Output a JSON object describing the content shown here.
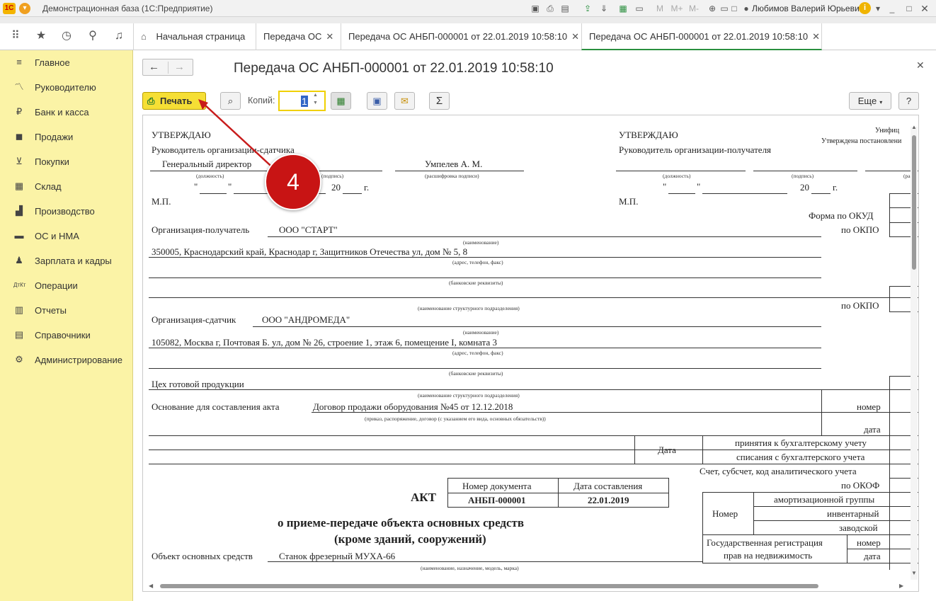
{
  "titlebar": {
    "title": "Демонстрационная база  (1С:Предприятие)",
    "user": "Любимов Валерий Юрьевич",
    "m_labels": [
      "M",
      "M+",
      "M-"
    ]
  },
  "tabs": [
    "Начальная страница",
    "Передача ОС",
    "Передача ОС АНБП-000001 от 22.01.2019 10:58:10",
    "Передача ОС АНБП-000001 от 22.01.2019 10:58:10"
  ],
  "sidebar": [
    {
      "label": "Главное",
      "icon": "menu-icon"
    },
    {
      "label": "Руководителю",
      "icon": "chart-line-icon"
    },
    {
      "label": "Банк и касса",
      "icon": "ruble-icon"
    },
    {
      "label": "Продажи",
      "icon": "bag-icon"
    },
    {
      "label": "Покупки",
      "icon": "cart-icon"
    },
    {
      "label": "Склад",
      "icon": "warehouse-icon"
    },
    {
      "label": "Производство",
      "icon": "factory-icon"
    },
    {
      "label": "ОС и НМА",
      "icon": "truck-icon"
    },
    {
      "label": "Зарплата и кадры",
      "icon": "person-icon"
    },
    {
      "label": "Операции",
      "icon": "dt-kt-icon"
    },
    {
      "label": "Отчеты",
      "icon": "bars-icon"
    },
    {
      "label": "Справочники",
      "icon": "book-icon"
    },
    {
      "label": "Администрирование",
      "icon": "gear-icon"
    }
  ],
  "page": {
    "title": "Передача ОС АНБП-000001 от 22.01.2019 10:58:10"
  },
  "toolbar": {
    "print_label": "Печать",
    "copies_label": "Копий:",
    "copies_value": "1",
    "more_label": "Еще",
    "help_label": "?",
    "sigma_label": "Σ"
  },
  "callout": {
    "number": "4"
  },
  "form": {
    "approve": "УТВЕРЖДАЮ",
    "head_sender": "Руководитель организации-сдатчика",
    "head_receiver": "Руководитель организации-получателя",
    "position": "Генеральный директор",
    "signer": "Умпелев А. М.",
    "cap_position": "(должность)",
    "cap_sign": "(подпись)",
    "cap_decode": "(расшифровка подписи)",
    "cap_decode_cut": "(расш",
    "quote": "\"",
    "year": "20",
    "g": "г.",
    "mp": "М.П.",
    "unif": "Унифиц",
    "approved_by": "Утверждена постановлени",
    "okud": "Форма по ОКУД",
    "okpo": "по ОКПО",
    "org_receiver_label": "Организация-получатель",
    "org_receiver": "ООО \"СТАРТ\"",
    "cap_name": "(наименование)",
    "addr_receiver": "350005, Краснодарский край, Краснодар г, Защитников Отечества ул, дом № 5, 8",
    "cap_addr": "(адрес, телефон, факс)",
    "cap_bank": "(банковские реквизиты)",
    "cap_struct": "(наименование структурного подразделения)",
    "org_sender_label": "Организация-сдатчик",
    "org_sender": "ООО \"АНДРОМЕДА\"",
    "addr_sender": "105082, Москва г, Почтовая Б. ул, дом № 26, строение 1, этаж 6, помещение I, комната 3",
    "workshop": "Цех готовой продукции",
    "basis_label": "Основание для составления акта",
    "basis": "Договор продажи оборудования №45 от 12.12.2018",
    "cap_basis": "(приказ, распоряжение, договор (с указанием его вида, основных обязательств))",
    "nomer": "номер",
    "data": "дата",
    "date_label": "Дата",
    "accept": "принятия к бухгалтерскому учету",
    "writeoff": "списания с бухгалтерского учета",
    "account": "Счет, субсчет, код аналитического учета",
    "okof": "по ОКОФ",
    "akt": "АКТ",
    "docnum_label": "Номер документа",
    "docdate_label": "Дата составления",
    "docnum": "АНБП-000001",
    "docdate": "22.01.2019",
    "number_label": "Номер",
    "amort": "амортизационной группы",
    "inventory": "инвентарный",
    "factory": "заводской",
    "title1": "о приеме-передаче объекта основных средств",
    "title2": "(кроме зданий, сооружений)",
    "state_reg": "Государственная регистрация",
    "rights": "прав на недвижимость",
    "nomer2": "номер",
    "data2": "дата",
    "object_label": "Объект основных средств",
    "object": "Станок фрезерный МУХА-66",
    "cap_object": "(наименование, назначение, модель, марка)"
  }
}
